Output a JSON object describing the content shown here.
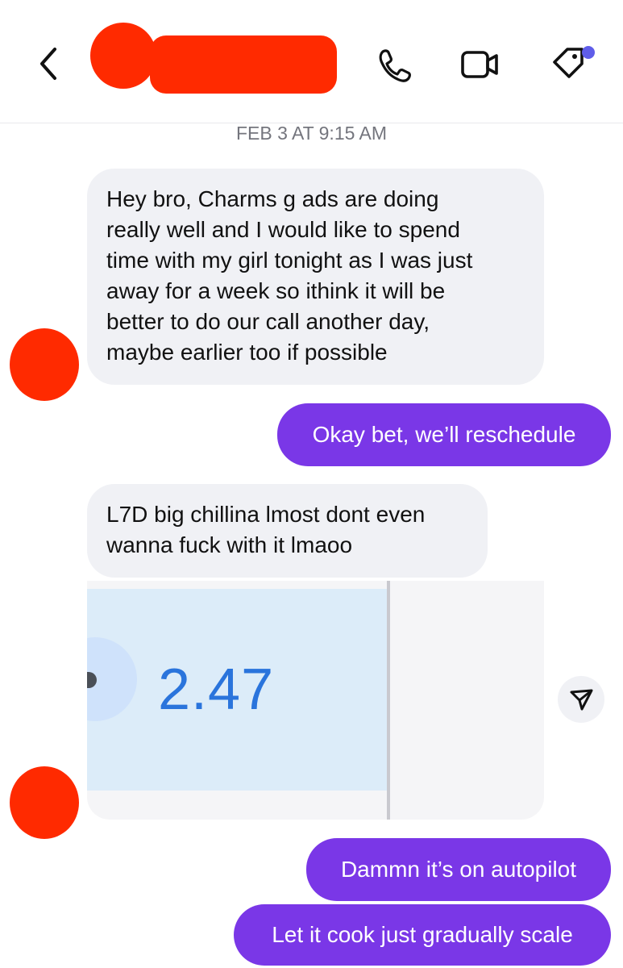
{
  "header": {
    "back_icon": "chevron-left-icon",
    "call_icon": "phone-icon",
    "video_icon": "video-camera-icon",
    "tag_icon": "tag-icon",
    "tag_badge_color": "#5f5de9",
    "redaction_color": "#ff2a00"
  },
  "timestamp": "FEB 3 AT 9:15 AM",
  "messages": [
    {
      "from": "them",
      "lines": [
        "Hey bro, Charms g ads are doing",
        "really well and I would like to spend",
        "time with my girl tonight as I was just",
        "away for a week so ithink it will be",
        "better to do our call another day,",
        "maybe earlier too if possible"
      ]
    },
    {
      "from": "me",
      "text": "Okay bet, we’ll reschedule"
    },
    {
      "from": "them",
      "lines": [
        "L7D big chillina lmost dont even",
        "wanna fuck with it lmaoo"
      ]
    },
    {
      "from": "me",
      "text": "Dammn it’s on autopilot"
    },
    {
      "from": "me",
      "text": "Let it cook just gradually scale"
    }
  ],
  "attachment": {
    "value": "2.47",
    "share_icon": "share-arrow-icon"
  },
  "colors": {
    "sent_bubble": "#7a37e7",
    "received_bubble": "#f0f1f5",
    "attachment_value": "#2a74dc"
  }
}
